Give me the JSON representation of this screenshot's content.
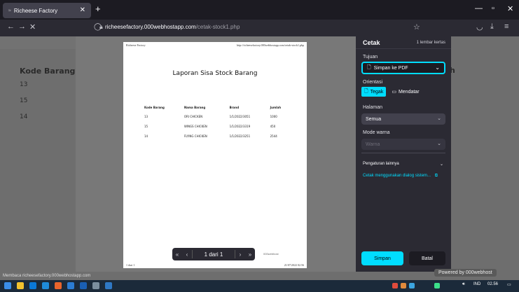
{
  "browser": {
    "tab_title": "Richeese Factory",
    "url_host": "richeesefactory.000webhostapp.com",
    "url_path": "/cetak-stock1.php",
    "status_text": "Membaca richeesefactory.000webhostapp.com",
    "powered_by": "Powered by 000webhost"
  },
  "background_page": {
    "label": "Kode Barang",
    "rows": [
      "13",
      "15",
      "14"
    ],
    "right_fragment": "h"
  },
  "preview": {
    "header_left": "Richeese Factory",
    "header_right": "http://richeesefactory.000webhostapp.com/cetak-stock1.php",
    "title": "Laporan Sisa Stock Barang",
    "columns": [
      "Kode Barang",
      "Nama Barang",
      "Brand",
      "Jumlah"
    ],
    "rows": [
      [
        "13",
        "ORI CHICKEN",
        "1/1/2022/3051",
        "1000"
      ],
      [
        "15",
        "WINGS CHICKEN",
        "1/1/2022/3319",
        "450"
      ],
      [
        "14",
        "FLYING CHICKEN",
        "1/1/2022/3251",
        "2544"
      ]
    ],
    "footer_left": "1 dari 1",
    "footer_right": "21/07/2022 02.56",
    "badge": "000webhost",
    "pager": "1 dari 1"
  },
  "print_panel": {
    "title": "Cetak",
    "sheets": "1 lembar kertas",
    "destination_label": "Tujuan",
    "destination_value": "Simpan ke PDF",
    "orientation_label": "Orientasi",
    "orientation_portrait": "Tegak",
    "orientation_landscape": "Mendatar",
    "pages_label": "Halaman",
    "pages_value": "Semua",
    "color_label": "Mode warna",
    "color_value": "Warna",
    "more_settings": "Pengaturan lainnya",
    "system_dialog": "Cetak menggunakan dialog sistem...",
    "save_button": "Simpan",
    "cancel_button": "Batal"
  },
  "taskbar": {
    "lang": "IND",
    "time": "02.56"
  }
}
